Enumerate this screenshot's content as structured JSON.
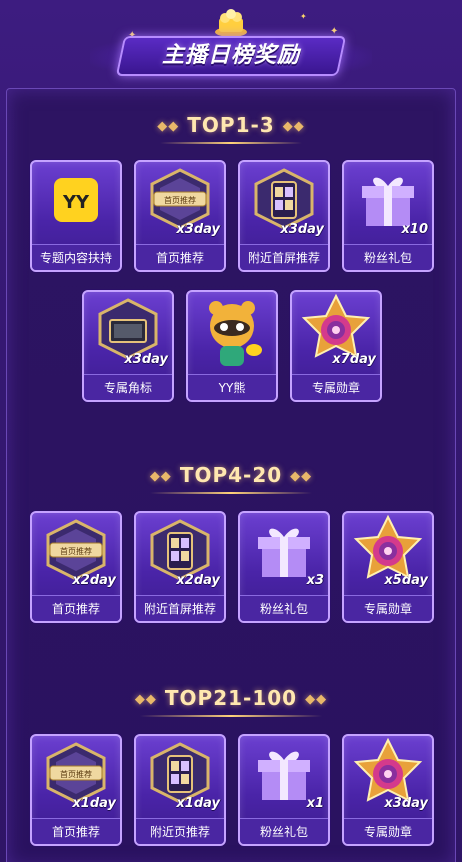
{
  "header": {
    "title": "主播日榜奖励"
  },
  "sections": [
    {
      "title": "TOP1-3",
      "items": [
        {
          "label": "专题内容扶持",
          "count": "",
          "icon": "yy-logo-icon"
        },
        {
          "label": "首页推荐",
          "count": "x3day",
          "icon": "homepage-badge-icon"
        },
        {
          "label": "附近首屏推荐",
          "count": "x3day",
          "icon": "phone-shield-icon"
        },
        {
          "label": "粉丝礼包",
          "count": "x10",
          "icon": "gift-box-icon"
        },
        {
          "label": "专属角标",
          "count": "x3day",
          "icon": "corner-badge-icon"
        },
        {
          "label": "YY熊",
          "count": "",
          "icon": "yy-bear-icon"
        },
        {
          "label": "专属勋章",
          "count": "x7day",
          "icon": "medal-icon"
        }
      ]
    },
    {
      "title": "TOP4-20",
      "items": [
        {
          "label": "首页推荐",
          "count": "x2day",
          "icon": "homepage-badge-icon"
        },
        {
          "label": "附近首屏推荐",
          "count": "x2day",
          "icon": "phone-shield-icon"
        },
        {
          "label": "粉丝礼包",
          "count": "x3",
          "icon": "gift-box-icon"
        },
        {
          "label": "专属勋章",
          "count": "x5day",
          "icon": "medal-icon"
        }
      ]
    },
    {
      "title": "TOP21-100",
      "items": [
        {
          "label": "首页推荐",
          "count": "x1day",
          "icon": "homepage-badge-icon"
        },
        {
          "label": "附近页推荐",
          "count": "x1day",
          "icon": "phone-shield-icon"
        },
        {
          "label": "粉丝礼包",
          "count": "x1",
          "icon": "gift-box-icon"
        },
        {
          "label": "专属勋章",
          "count": "x3day",
          "icon": "medal-icon"
        }
      ]
    }
  ],
  "badge_text": {
    "homepage": "首页推荐"
  },
  "colors": {
    "background": "#3a1a78",
    "card_border": "#c5a3ff",
    "title_gold": "#ffe7b0",
    "yy_yellow": "#ffd21f"
  }
}
